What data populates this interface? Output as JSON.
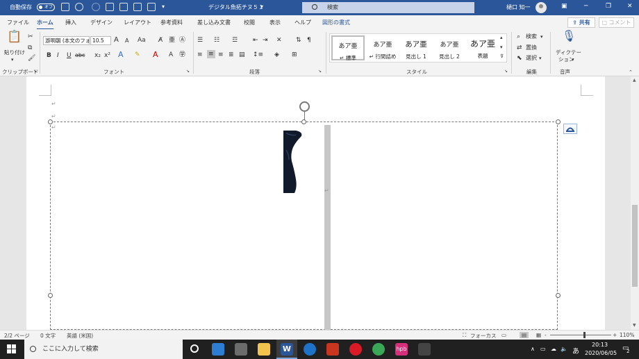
{
  "titlebar": {
    "autosave_label": "自動保存",
    "autosave_state": "オフ",
    "doc_title": "デジタル魚拓チヌ５１",
    "search_placeholder": "検索",
    "user_name": "樋口 知一"
  },
  "tabs": [
    "ファイル",
    "ホーム",
    "挿入",
    "デザイン",
    "レイアウト",
    "参考資料",
    "差し込み文書",
    "校閲",
    "表示",
    "ヘルプ",
    "図形の書式"
  ],
  "active_tab": "ホーム",
  "actions": {
    "share": "共有",
    "comment": "コメント"
  },
  "ribbon": {
    "clipboard": {
      "paste": "貼り付け",
      "label": "クリップボード"
    },
    "font": {
      "face": "游明朝 (本文のフォ",
      "size": "10.5",
      "label": "フォント",
      "bold": "B",
      "italic": "I",
      "underline": "U",
      "strike": "abc",
      "sub": "x₂",
      "sup": "x²",
      "aa": "Aa",
      "grow": "A",
      "shrink": "A"
    },
    "paragraph": {
      "label": "段落"
    },
    "styles": {
      "label": "スタイル",
      "items": [
        {
          "preview": "あア亜",
          "name": "↵ 標準"
        },
        {
          "preview": "あア亜",
          "name": "↵ 行間詰め"
        },
        {
          "preview": "あア亜",
          "name": "見出し 1"
        },
        {
          "preview": "あア亜",
          "name": "見出し 2"
        },
        {
          "preview": "あア亜",
          "name": "表題"
        }
      ]
    },
    "editing": {
      "label": "編集",
      "find": "検索",
      "replace": "置換",
      "select": "選択"
    },
    "voice": {
      "label": "音声",
      "dictate": "ディクテー",
      "dictate2": "ション"
    }
  },
  "document": {
    "para_mark": "↵"
  },
  "status": {
    "page": "2/2 ページ",
    "words": "0 文字",
    "lang": "英語 (米国)",
    "focus": "フォーカス",
    "zoom": "110%",
    "zoom_minus": "-",
    "zoom_plus": "+"
  },
  "taskbar": {
    "search_placeholder": "ここに入力して検索",
    "time": "20:13",
    "date": "2020/06/05",
    "ime": "あ",
    "notifications": "2"
  },
  "colors": {
    "accent": "#2b579a",
    "taskbar": "#202020"
  }
}
